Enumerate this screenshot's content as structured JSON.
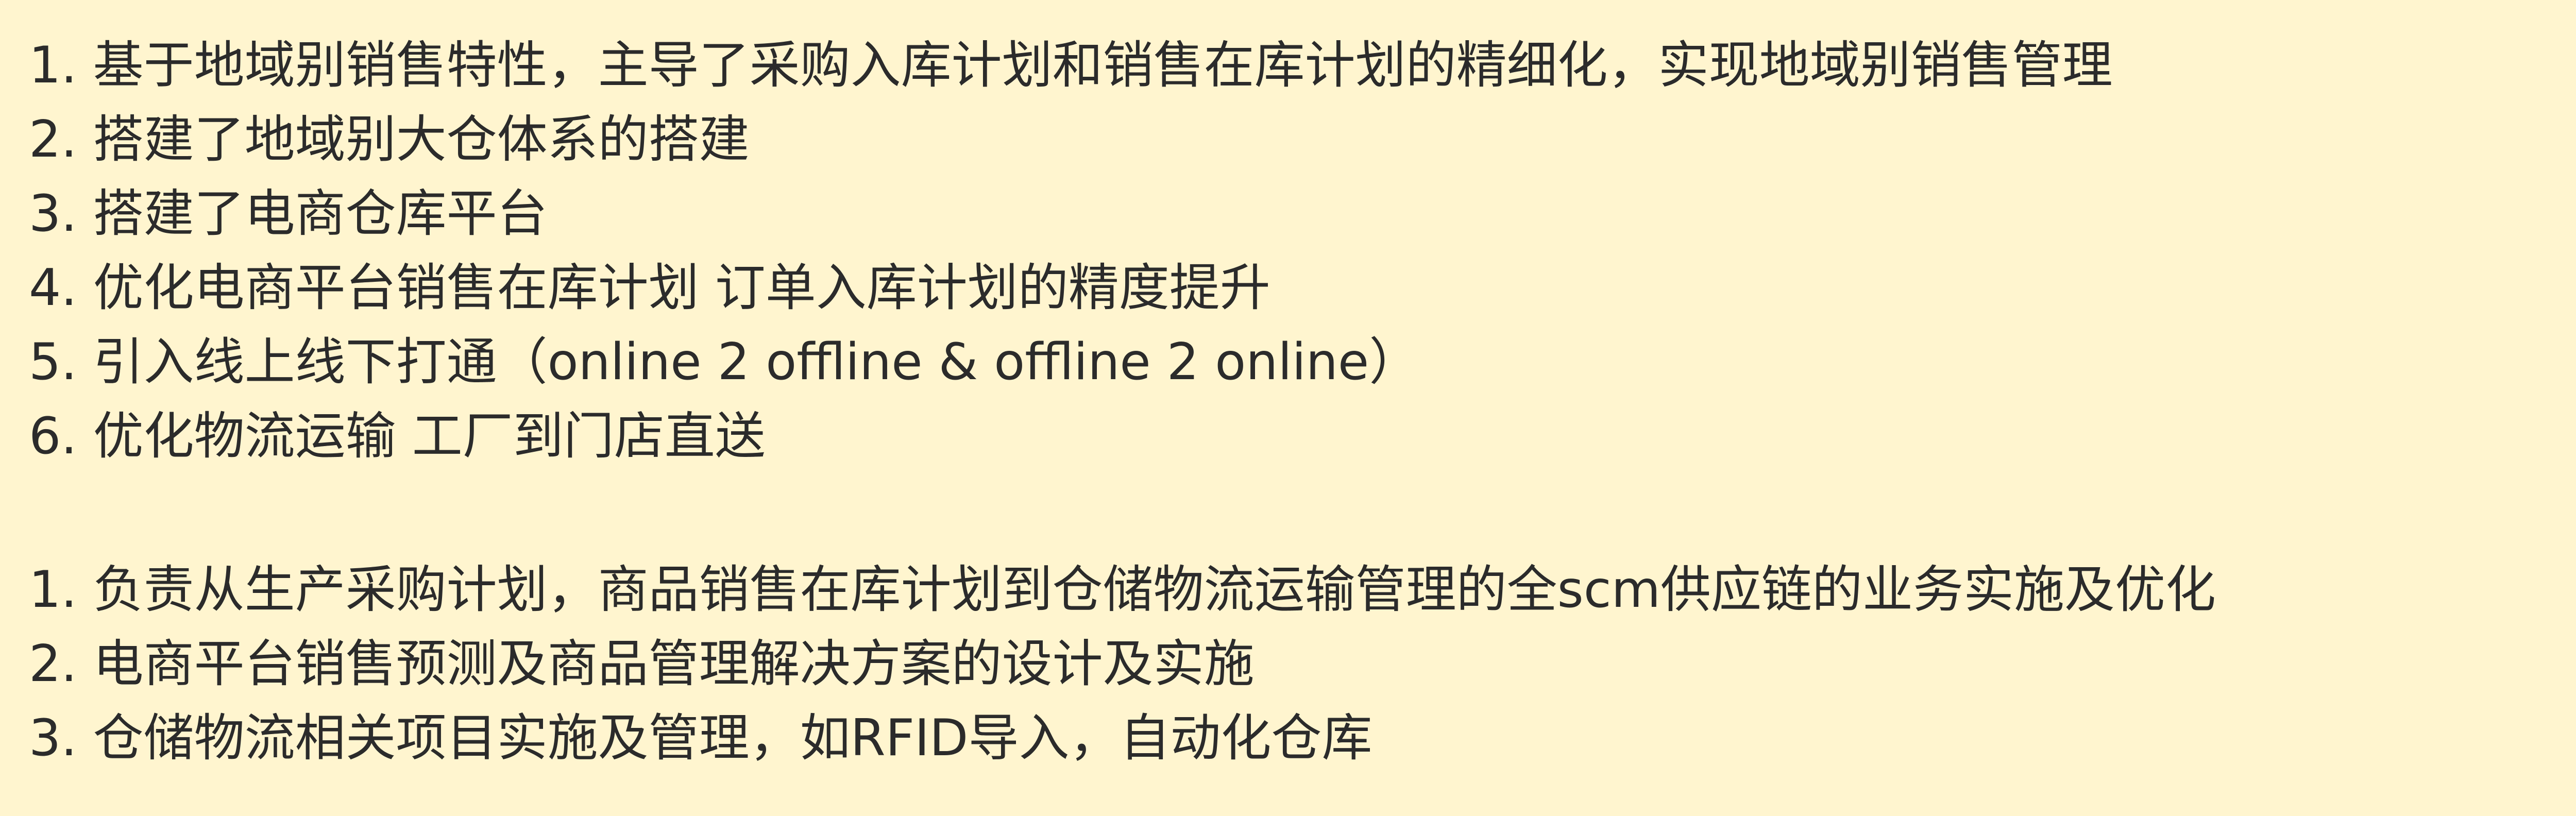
{
  "achievements": [
    "1. 基于地域别销售特性，主导了采购入库计划和销售在库计划的精细化，实现地域别销售管理",
    "2. 搭建了地域别大仓体系的搭建",
    "3. 搭建了电商仓库平台",
    "4. 优化电商平台销售在库计划 订单入库计划的精度提升",
    "5. 引入线上线下打通（online 2 offline & offline 2 online）",
    "6. 优化物流运输 工厂到门店直送"
  ],
  "responsibilities": [
    "1. 负责从生产采购计划，商品销售在库计划到仓储物流运输管理的全scm供应链的业务实施及优化",
    "2. 电商平台销售预测及商品管理解决方案的设计及实施",
    "3. 仓储物流相关项目实施及管理，如RFID导入，自动化仓库"
  ]
}
